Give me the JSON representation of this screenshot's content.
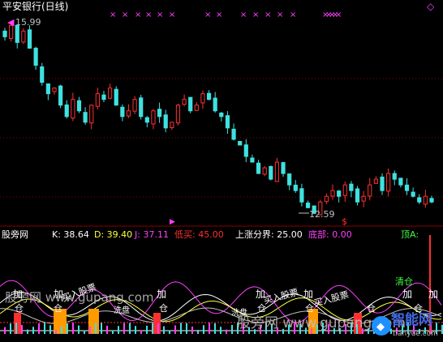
{
  "header": {
    "title": "平安银行(日线)",
    "top_marker_glyph": "◇"
  },
  "price_panel": {
    "high_label": "15.99",
    "low_label": "12.59",
    "signal_glyph": "$",
    "top_signal_glyph": "×",
    "bottom_arrow_glyph": "▶"
  },
  "indicator_header": {
    "name": "股旁网",
    "k_label": "K: 38.64",
    "d_label": "D: 39.40",
    "j_label": "J: 37.11",
    "buy_label": "低买: 45.00",
    "boundary_label": "上涨分界: 25.00",
    "bottom_label": "底部: 0.00",
    "top_label": "顶A:"
  },
  "indicator_panel": {
    "add_label": "加",
    "add_sub_label": "仓",
    "buy_stock_label": "买入股票",
    "wash_label": "洗盘",
    "clear_label": "清仓",
    "watermark_1": "股旁网 www.gupang.com",
    "watermark_2": "智能网",
    "watermark_3": "tianyue.com"
  },
  "colors": {
    "up": "#ff3030",
    "down": "#40e0e0",
    "k": "#ffffff",
    "d": "#ffff40",
    "j": "#ff40ff",
    "buy": "#ff3030",
    "boundary": "#ffffff",
    "bottom": "#ff40ff",
    "top": "#40ff40",
    "grid": "#8b0000",
    "orange": "#ff9900"
  },
  "chart_data": {
    "type": "candlestick",
    "title": "平安银行(日线)",
    "y_high": 15.99,
    "y_low": 12.59,
    "series": [
      {
        "name": "K",
        "last": 38.64
      },
      {
        "name": "D",
        "last": 39.4
      },
      {
        "name": "J",
        "last": 37.11
      },
      {
        "name": "低买",
        "last": 45.0
      },
      {
        "name": "上涨分界",
        "last": 25.0
      },
      {
        "name": "底部",
        "last": 0.0
      }
    ],
    "close_path": [
      15.7,
      15.9,
      15.6,
      15.8,
      15.5,
      15.2,
      14.9,
      14.7,
      14.8,
      14.5,
      14.3,
      14.6,
      14.4,
      14.2,
      14.5,
      14.7,
      14.6,
      14.8,
      14.5,
      14.3,
      14.4,
      14.6,
      14.3,
      14.2,
      14.4,
      14.3,
      14.1,
      14.2,
      14.5,
      14.6,
      14.4,
      14.5,
      14.7,
      14.6,
      14.4,
      14.3,
      14.1,
      13.9,
      13.8,
      13.6,
      13.5,
      13.3,
      13.4,
      13.2,
      13.5,
      13.3,
      13.1,
      13.0,
      12.8,
      12.7,
      12.6,
      12.8,
      12.9,
      13.0,
      12.9,
      13.1,
      13.0,
      12.8,
      12.9,
      13.1,
      13.2,
      13.0,
      13.3,
      13.2,
      13.1,
      13.0,
      12.9,
      12.8,
      12.9,
      12.8
    ]
  }
}
